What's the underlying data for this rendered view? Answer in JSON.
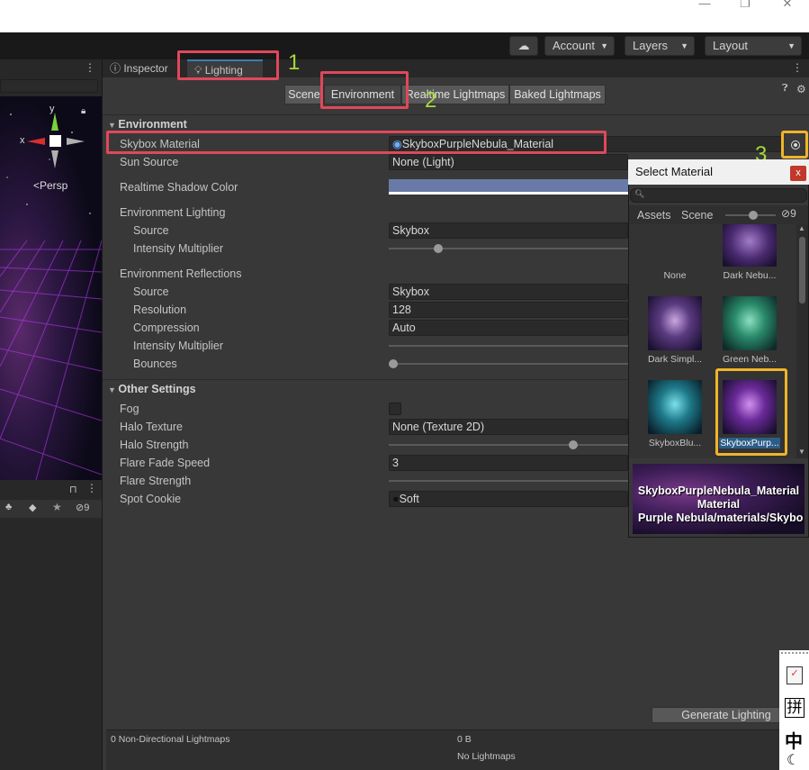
{
  "window": {
    "min_icon": "minimize-icon",
    "max_icon": "restore-icon",
    "close_icon": "close-icon"
  },
  "toolbar": {
    "account": "Account",
    "layers": "Layers",
    "layout": "Layout"
  },
  "scene": {
    "gizmo_y": "y",
    "gizmo_x": "x",
    "persp": "<Persp",
    "hidden_count": "9"
  },
  "tabs": {
    "inspector": "Inspector",
    "lighting": "Lighting"
  },
  "segments": [
    "Scene",
    "Environment",
    "Realtime Lightmaps",
    "Baked Lightmaps"
  ],
  "annotations": {
    "n1": "1",
    "n2": "2",
    "n3": "3"
  },
  "environment": {
    "header": "Environment",
    "skybox_label": "Skybox Material",
    "skybox_value": "SkyboxPurpleNebula_Material",
    "sun_label": "Sun Source",
    "sun_value": "None (Light)",
    "shadow_label": "Realtime Shadow Color",
    "shadow_color": "#6a7aa8",
    "env_lighting": "Environment Lighting",
    "source_label": "Source",
    "source_value": "Skybox",
    "intensity_label": "Intensity Multiplier",
    "env_reflections": "Environment Reflections",
    "refl_source_label": "Source",
    "refl_source_value": "Skybox",
    "resolution_label": "Resolution",
    "resolution_value": "128",
    "compression_label": "Compression",
    "compression_value": "Auto",
    "refl_intensity_label": "Intensity Multiplier",
    "bounces_label": "Bounces"
  },
  "other": {
    "header": "Other Settings",
    "fog_label": "Fog",
    "halo_texture_label": "Halo Texture",
    "halo_texture_value": "None (Texture 2D)",
    "halo_strength_label": "Halo Strength",
    "flare_fade_label": "Flare Fade Speed",
    "flare_fade_value": "3",
    "flare_strength_label": "Flare Strength",
    "spot_cookie_label": "Spot Cookie",
    "spot_cookie_value": "Soft"
  },
  "picker": {
    "title": "Select Material",
    "close": "x",
    "tab_assets": "Assets",
    "tab_scene": "Scene",
    "hidden_count": "9",
    "items": [
      {
        "label": "None"
      },
      {
        "label": "Dark Nebu..."
      },
      {
        "label": "Dark Simpl..."
      },
      {
        "label": "Green Neb..."
      },
      {
        "label": "SkyboxBlu..."
      },
      {
        "label": "SkyboxPurp..."
      }
    ],
    "preview_line1": "SkyboxPurpleNebula_Material",
    "preview_line2": "Material",
    "preview_line3": "Purple Nebula/materials/Skybo"
  },
  "bottom": {
    "generate": "Generate Lighting",
    "lightmaps": "0 Non-Directional Lightmaps",
    "size": "0 B",
    "no_lightmaps": "No Lightmaps"
  },
  "ime": {
    "pin": "拼",
    "zh": "中"
  },
  "colors": {
    "highlight_red": "#e0485a",
    "highlight_yellow": "#f0b429",
    "annotation_green": "#a7d93a",
    "accent_blue": "#3a79bb"
  }
}
